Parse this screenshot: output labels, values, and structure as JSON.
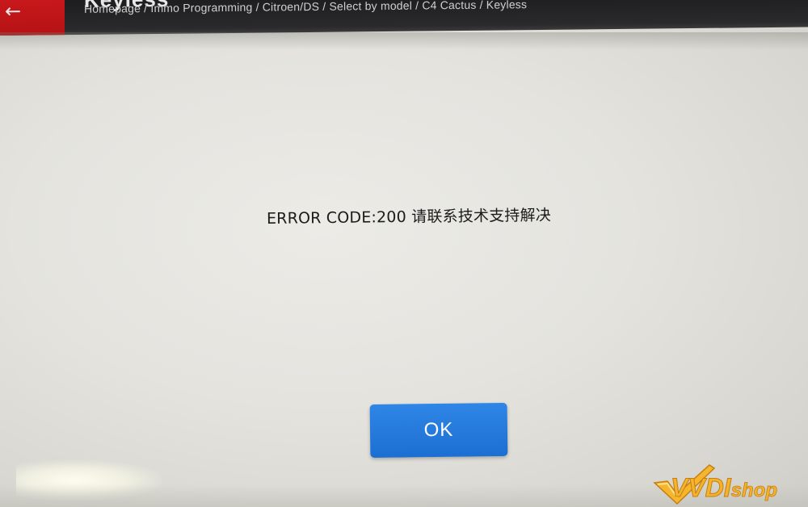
{
  "header": {
    "title": "Keyless",
    "breadcrumb": "Homepage / Immo Programming / Citroen/DS / Select by model / C4 Cactus / Keyless",
    "back_icon": "back-arrow-icon"
  },
  "dialog": {
    "message": "ERROR CODE:200 请联系技术支持解决",
    "ok_label": "OK"
  },
  "watermark": {
    "brand": "VVDI",
    "suffix": "shop"
  },
  "colors": {
    "back_block": "#c8181c",
    "topbar": "#1d1d1f",
    "ok_button": "#1c6fd2",
    "watermark": "#f3b32b"
  }
}
